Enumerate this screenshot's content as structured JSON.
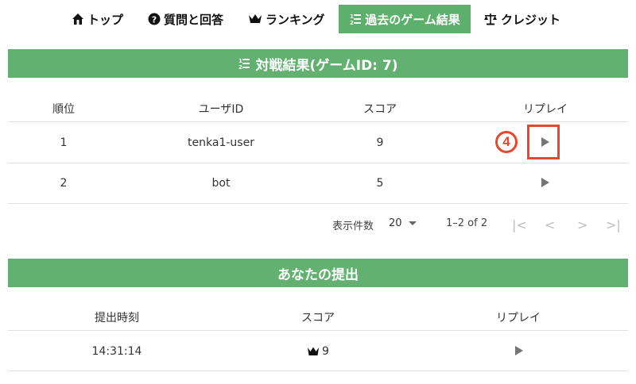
{
  "nav": {
    "items": [
      {
        "label": "トップ",
        "icon": "home-icon"
      },
      {
        "label": "質問と回答",
        "icon": "question-icon"
      },
      {
        "label": "ランキング",
        "icon": "crown-icon"
      },
      {
        "label": "過去のゲーム結果",
        "icon": "ordered-list-icon",
        "active": true
      },
      {
        "label": "クレジット",
        "icon": "scale-icon"
      }
    ]
  },
  "results": {
    "title": "対戦結果(ゲームID: 7)",
    "columns": [
      "順位",
      "ユーザID",
      "スコア",
      "リプレイ"
    ],
    "rows": [
      {
        "rank": "1",
        "user": "tenka1-user",
        "score": "9"
      },
      {
        "rank": "2",
        "user": "bot",
        "score": "5"
      }
    ],
    "pagination": {
      "rows_per_page_label": "表示件数",
      "rows_per_page": "20",
      "range": "1–2 of 2"
    }
  },
  "annotation": {
    "step": "4"
  },
  "submissions": {
    "title": "あなたの提出",
    "columns": [
      "提出時刻",
      "スコア",
      "リプレイ"
    ],
    "rows": [
      {
        "time": "14:31:14",
        "score": "9"
      }
    ]
  },
  "colors": {
    "accent": "#63b170",
    "highlight": "#e8472b"
  }
}
